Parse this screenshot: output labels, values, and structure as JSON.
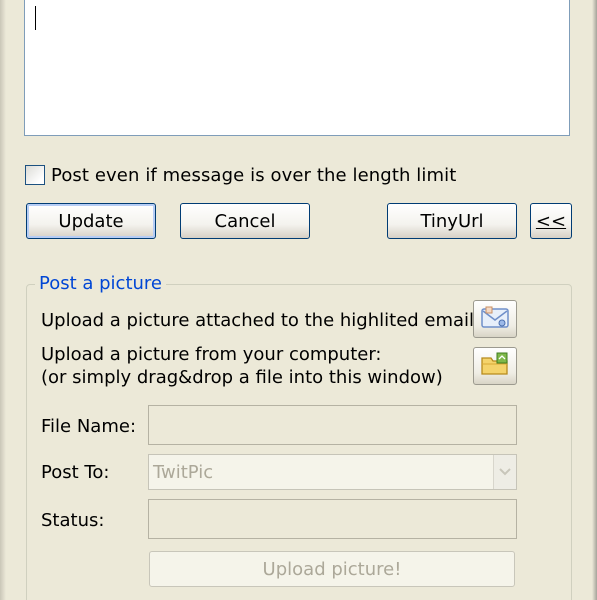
{
  "message": {
    "value": ""
  },
  "options": {
    "post_over_limit_label": "Post even if message is over the length limit",
    "post_over_limit_checked": false
  },
  "buttons": {
    "update": "Update",
    "cancel": "Cancel",
    "tinyurl": "TinyUrl",
    "collapse": "<<"
  },
  "picture": {
    "legend": "Post a picture",
    "upload_email_label": "Upload a picture attached to the highlited email:",
    "upload_email_icon": "email-attachment-icon",
    "upload_computer_label": "Upload a picture from your computer:",
    "upload_computer_hint": "(or simply drag&drop a file into this window)",
    "upload_computer_icon": "folder-open-icon",
    "file_name_label": "File Name:",
    "file_name_value": "",
    "post_to_label": "Post To:",
    "post_to_value": "TwitPic",
    "status_label": "Status:",
    "status_value": "",
    "upload_button": "Upload picture!"
  }
}
